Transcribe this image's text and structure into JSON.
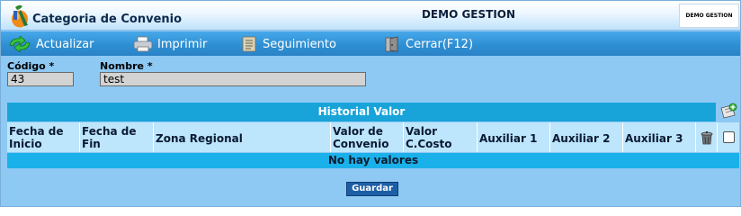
{
  "window": {
    "title": "Categoria de Convenio",
    "company": "DEMO GESTION",
    "company_logo_text": "DEMO GESTION"
  },
  "toolbar": {
    "items": [
      {
        "label": "Actualizar",
        "icon": "refresh-arrows-icon"
      },
      {
        "label": "Imprimir",
        "icon": "printer-icon"
      },
      {
        "label": "Seguimiento",
        "icon": "tracking-icon"
      },
      {
        "label": "Cerrar(F12)",
        "icon": "close-door-icon"
      }
    ]
  },
  "form": {
    "codigo": {
      "label": "Código *",
      "value": "43"
    },
    "nombre": {
      "label": "Nombre *",
      "value": "test"
    }
  },
  "grid": {
    "title": "Historial Valor",
    "columns": [
      {
        "label": "Fecha de Inicio"
      },
      {
        "label": "Fecha de Fin"
      },
      {
        "label": "Zona Regional"
      },
      {
        "label": "Valor de Convenio"
      },
      {
        "label": "Valor C.Costo"
      },
      {
        "label": "Auxiliar 1"
      },
      {
        "label": "Auxiliar 2"
      },
      {
        "label": "Auxiliar 3"
      }
    ],
    "empty_message": "No hay valores",
    "add_icon": "add-row-icon",
    "delete_icon": "trash-can-icon"
  },
  "actions": {
    "save_label": "Guardar"
  },
  "colors": {
    "background": "#8ec9f4",
    "toolbar": "#2f8fd3",
    "grid_title": "#18a4d9",
    "grid_header": "#bde5fb",
    "empty_row": "#1ab1ea",
    "save_button": "#1d5fa6"
  }
}
